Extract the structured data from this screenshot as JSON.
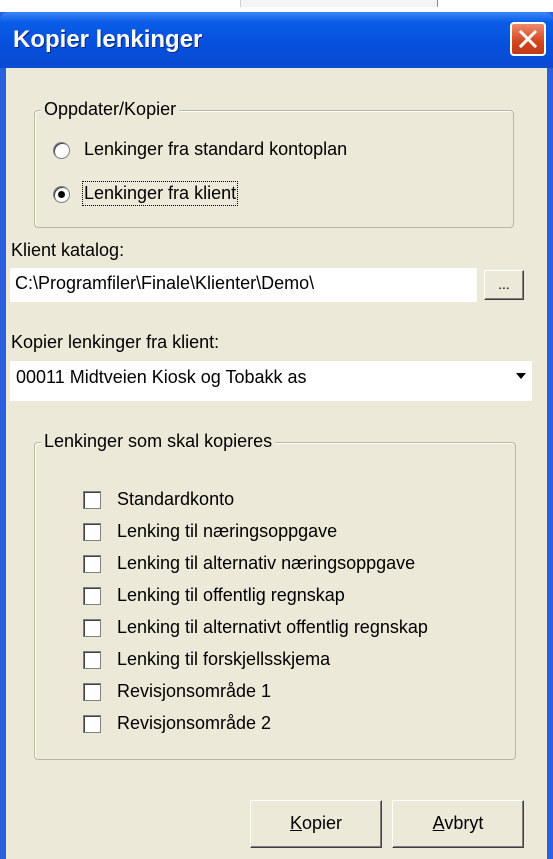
{
  "window": {
    "title": "Kopier lenkinger"
  },
  "update_group": {
    "legend": "Oppdater/Kopier",
    "options": [
      {
        "label": "Lenkinger fra standard kontoplan",
        "selected": false
      },
      {
        "label": "Lenkinger fra klient",
        "selected": true
      }
    ]
  },
  "client_folder": {
    "label": "Klient katalog:",
    "value": "C:\\Programfiler\\Finale\\Klienter\\Demo\\",
    "browse_label": "..."
  },
  "copy_from": {
    "label": "Kopier lenkinger fra klient:",
    "selected": "00011  Midtveien Kiosk og Tobakk as"
  },
  "links_group": {
    "legend": "Lenkinger som skal kopieres",
    "items": [
      {
        "label": "Standardkonto",
        "checked": false
      },
      {
        "label": "Lenking til næringsoppgave",
        "checked": false
      },
      {
        "label": "Lenking til alternativ næringsoppgave",
        "checked": false
      },
      {
        "label": "Lenking til offentlig regnskap",
        "checked": false
      },
      {
        "label": "Lenking til alternativt offentlig regnskap",
        "checked": false
      },
      {
        "label": "Lenking til forskjellsskjema",
        "checked": false
      },
      {
        "label": "Revisjonsområde 1",
        "checked": false
      },
      {
        "label": "Revisjonsområde 2",
        "checked": false
      }
    ]
  },
  "buttons": {
    "copy": {
      "mnemonic": "K",
      "rest": "opier"
    },
    "cancel": {
      "mnemonic": "A",
      "rest": "vbryt"
    }
  },
  "colors": {
    "titlebar": "#0650dc",
    "dialog_face": "#ece9d8",
    "close_button": "#d24520"
  }
}
